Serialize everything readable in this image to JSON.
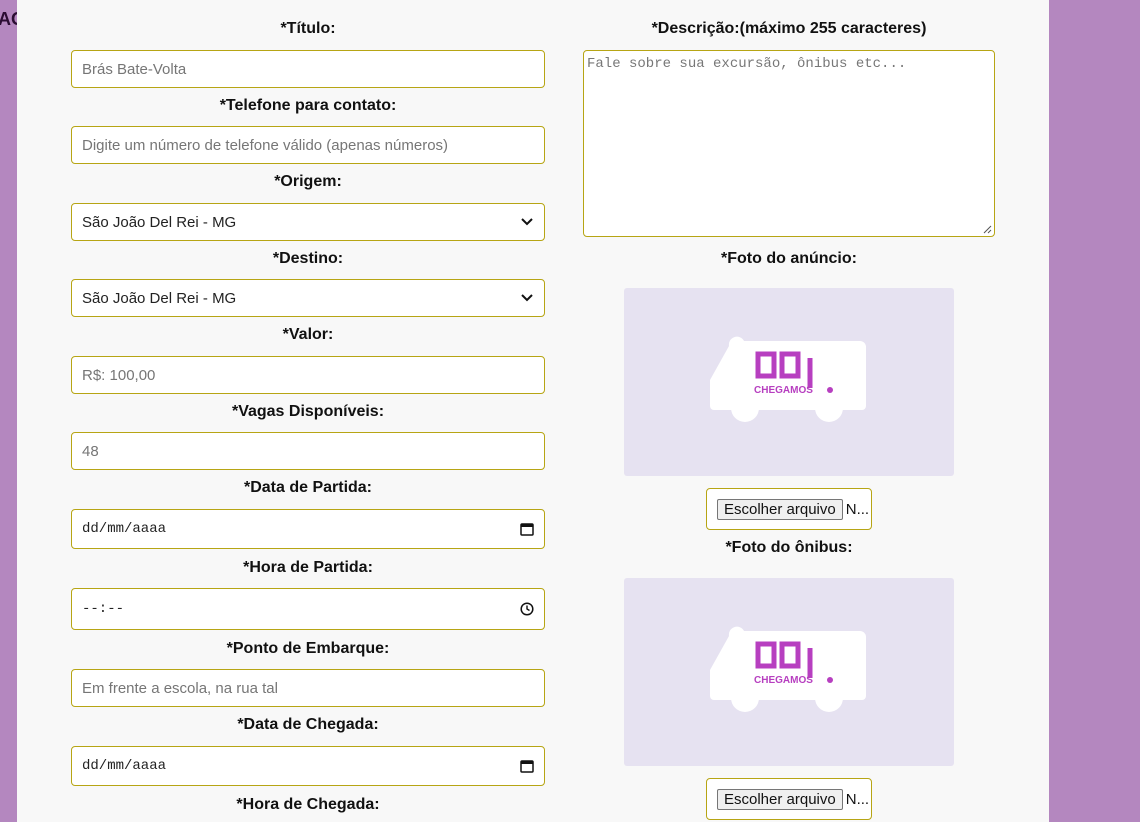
{
  "edge_text": "AO",
  "form": {
    "titulo": {
      "label": "*Título:",
      "placeholder": "Brás Bate-Volta"
    },
    "telefone": {
      "label": "*Telefone para contato:",
      "placeholder": "Digite um número de telefone válido (apenas números)"
    },
    "origem": {
      "label": "*Origem:",
      "value": "São João Del Rei - MG"
    },
    "destino": {
      "label": "*Destino:",
      "value": "São João Del Rei - MG"
    },
    "valor": {
      "label": "*Valor:",
      "placeholder": "R$: 100,00"
    },
    "vagas": {
      "label": "*Vagas Disponíveis:",
      "placeholder": "48"
    },
    "data_partida": {
      "label": "*Data de Partida:",
      "placeholder": "dd/mm/aaaa"
    },
    "hora_partida": {
      "label": "*Hora de Partida:",
      "placeholder": "--:--"
    },
    "embarque": {
      "label": "*Ponto de Embarque:",
      "placeholder": "Em frente a escola, na rua tal"
    },
    "data_chegada": {
      "label": "*Data de Chegada:",
      "placeholder": "dd/mm/aaaa"
    },
    "hora_chegada": {
      "label": "*Hora de Chegada:"
    },
    "descricao": {
      "label": "*Descrição:(máximo 255 caracteres)",
      "placeholder": "Fale sobre sua excursão, ônibus etc..."
    },
    "foto_anuncio": {
      "label": "*Foto do anúncio:",
      "button": "Escolher arquivo",
      "filename": "N..."
    },
    "foto_onibus": {
      "label": "*Foto do ônibus:",
      "button": "Escolher arquivo",
      "filename": "N..."
    }
  },
  "logo": {
    "text": "CHEGAMOS"
  },
  "colors": {
    "background": "#b487bf",
    "panel": "#f8f8f8",
    "border": "#b7a514",
    "brand": "#b73fc0",
    "photo_bg": "#e6e2f1"
  },
  "icons": {
    "select": "chevron-down-icon",
    "date": "calendar-icon",
    "time": "clock-icon"
  }
}
